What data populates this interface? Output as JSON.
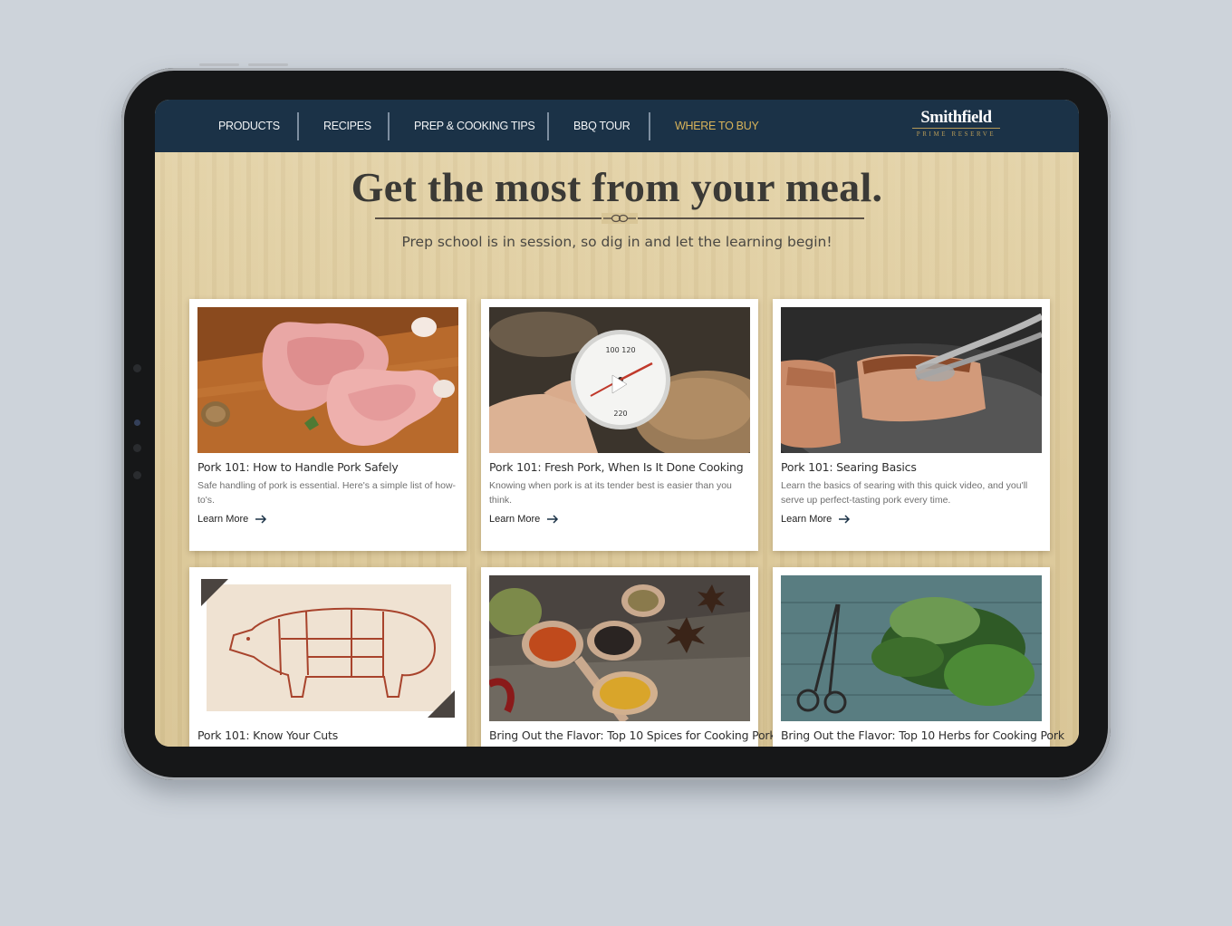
{
  "nav": {
    "items": [
      {
        "label": "PRODUCTS"
      },
      {
        "label": "RECIPES"
      },
      {
        "label": "PREP & COOKING TIPS"
      },
      {
        "label": "BBQ TOUR"
      },
      {
        "label": "WHERE TO BUY"
      }
    ],
    "accent_color": "#d8b35a",
    "background_color": "#1b3247"
  },
  "logo": {
    "name": "Smithfield",
    "tagline": "PRIME RESERVE"
  },
  "hero": {
    "headline": "Get the most from your meal.",
    "subhead": "Prep school is in session, so dig in and let the learning begin!"
  },
  "cards": [
    {
      "title": "Pork 101: How to Handle Pork Safely",
      "description": "Safe handling of pork is essential. Here's a simple list of how-to's.",
      "link": "Learn More",
      "image": "raw pork chops on cutting board"
    },
    {
      "title": "Pork 101: Fresh Pork, When Is It Done Cooking",
      "description": "Knowing when pork is at its tender best is easier than you think.",
      "link": "Learn More",
      "image": "meat thermometer in hand"
    },
    {
      "title": "Pork 101: Searing Basics",
      "description": "Learn the basics of searing with this quick video, and you'll serve up perfect-tasting pork every time.",
      "link": "Learn More",
      "image": "pork searing in skillet with tongs"
    },
    {
      "title": "Pork 101: Know Your Cuts",
      "description": "",
      "link": "",
      "image": "pork cuts diagram"
    },
    {
      "title": "Bring Out the Flavor: Top 10 Spices for Cooking Pork",
      "description": "",
      "link": "",
      "image": "spices on wooden spoons"
    },
    {
      "title": "Bring Out the Flavor: Top 10 Herbs for Cooking Pork",
      "description": "",
      "link": "",
      "image": "fresh herbs with scissors"
    }
  ]
}
